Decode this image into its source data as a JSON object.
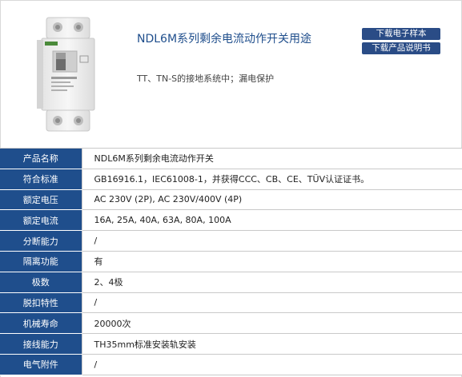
{
  "product": {
    "title": "NDL6M系列剩余电流动作开关用途",
    "subtitle": "TT、TN-S的接地系统中；漏电保护"
  },
  "buttons": {
    "download_sample": "下载电子样本",
    "download_manual": "下载产品说明书"
  },
  "specs": [
    {
      "label": "产品名称",
      "value": "NDL6M系列剩余电流动作开关"
    },
    {
      "label": "符合标准",
      "value": "GB16916.1，IEC61008-1，并获得CCC、CB、CE、TÜV认证证书。"
    },
    {
      "label": "额定电压",
      "value": "AC 230V (2P), AC 230V/400V (4P)"
    },
    {
      "label": "额定电流",
      "value": "16A, 25A, 40A, 63A, 80A, 100A"
    },
    {
      "label": "分断能力",
      "value": "/"
    },
    {
      "label": "隔离功能",
      "value": "有"
    },
    {
      "label": "极数",
      "value": "2、4极"
    },
    {
      "label": "脱扣特性",
      "value": "/"
    },
    {
      "label": "机械寿命",
      "value": "20000次"
    },
    {
      "label": "接线能力",
      "value": "TH35mm标准安装轨安装"
    },
    {
      "label": "电气附件",
      "value": "/"
    }
  ],
  "colors": {
    "accent": "#1f4e8c",
    "button": "#2a4c86"
  }
}
